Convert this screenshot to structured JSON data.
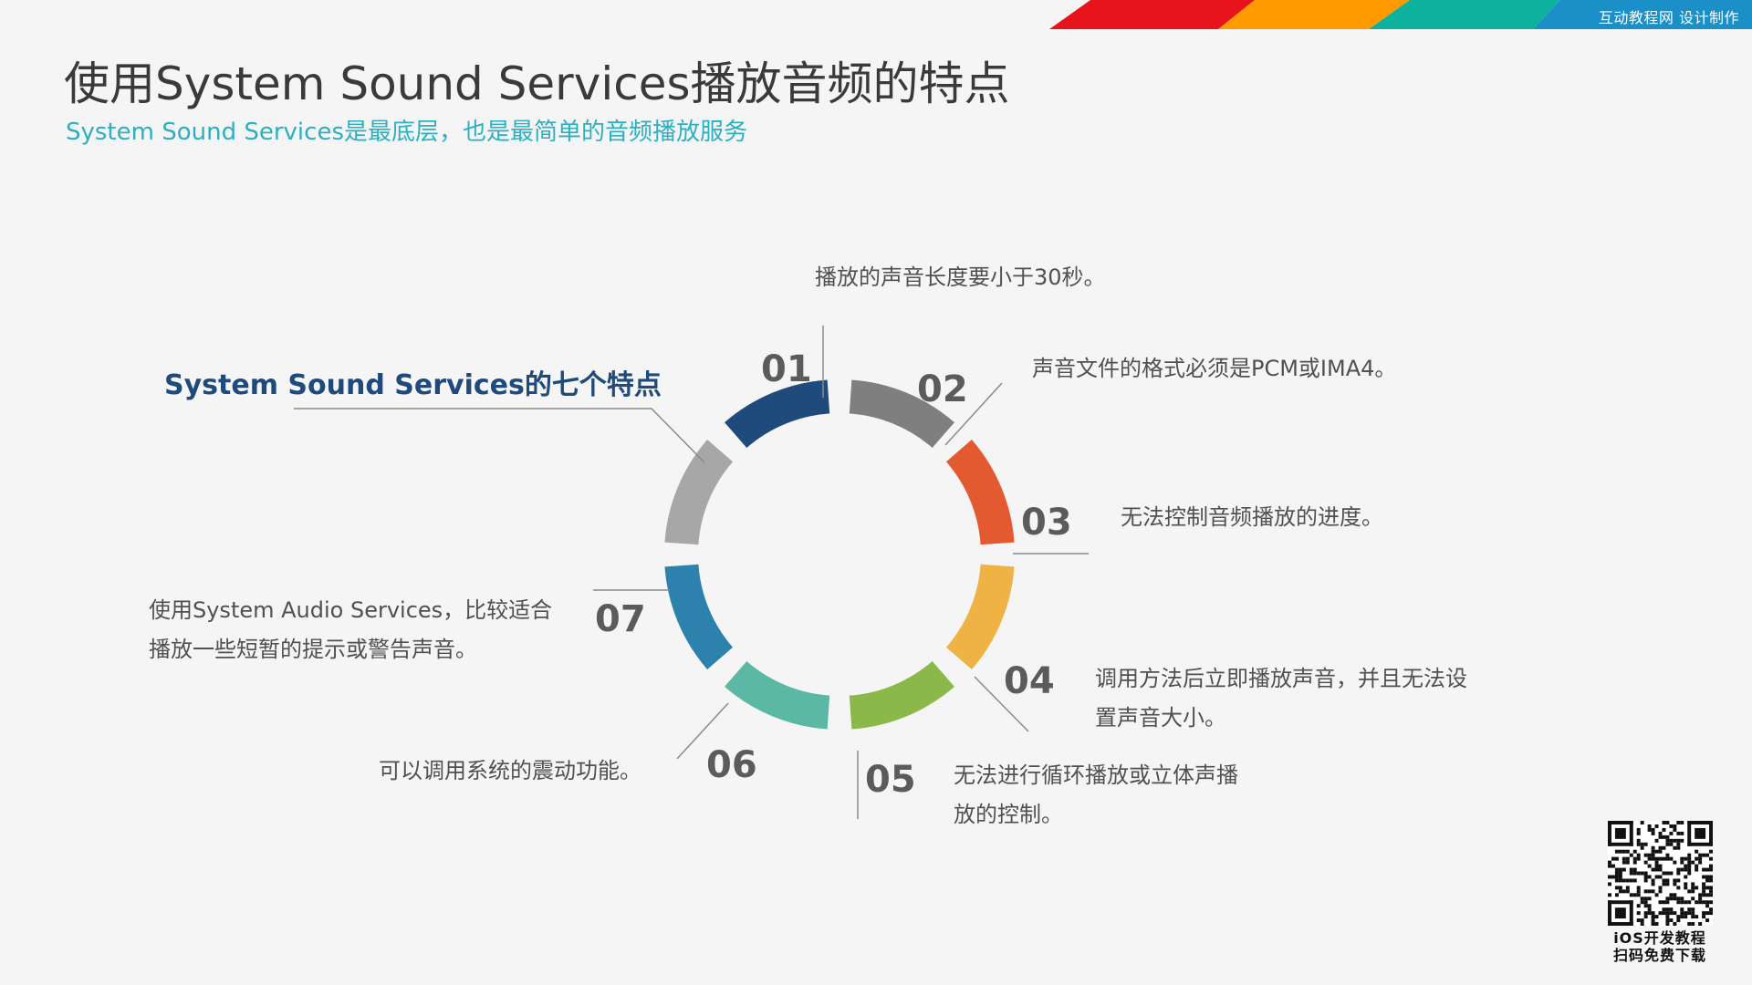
{
  "header": {
    "band_caption": "互动教程网 设计制作",
    "band_colors": [
      "#e8141b",
      "#ff9a00",
      "#0db29e",
      "#1a8fc8"
    ]
  },
  "title": "使用System Sound Services播放音频的特点",
  "subtitle": "System Sound Services是最底层，也是最简单的音频播放服务",
  "center_title": "System Sound Services的七个特点",
  "features": [
    {
      "num": "01",
      "color": "#7f7f7f",
      "lines": [
        "播放的声音长度要小于30秒。"
      ]
    },
    {
      "num": "02",
      "color": "#e35a31",
      "lines": [
        "声音文件的格式必须是PCM或IMA4。"
      ]
    },
    {
      "num": "03",
      "color": "#efb345",
      "lines": [
        "无法控制音频播放的进度。"
      ]
    },
    {
      "num": "04",
      "color": "#8ab94a",
      "lines": [
        "调用方法后立即播放声音，并且无法设",
        "置声音大小。"
      ]
    },
    {
      "num": "05",
      "color": "#5bb8a4",
      "lines": [
        "无法进行循环播放或立体声播",
        "放的控制。"
      ]
    },
    {
      "num": "06",
      "color": "#2d81ad",
      "lines": [
        "可以调用系统的震动功能。"
      ]
    },
    {
      "num": "07",
      "color": "#a7a7a7",
      "lines": [
        "使用System Audio Services，比较适合",
        "播放一些短暂的提示或警告声音。"
      ]
    },
    {
      "num": "",
      "color": "#1f4a7c",
      "lines": []
    }
  ],
  "qr": {
    "caption_line1": "iOS开发教程",
    "caption_line2": "扫码免费下载"
  }
}
